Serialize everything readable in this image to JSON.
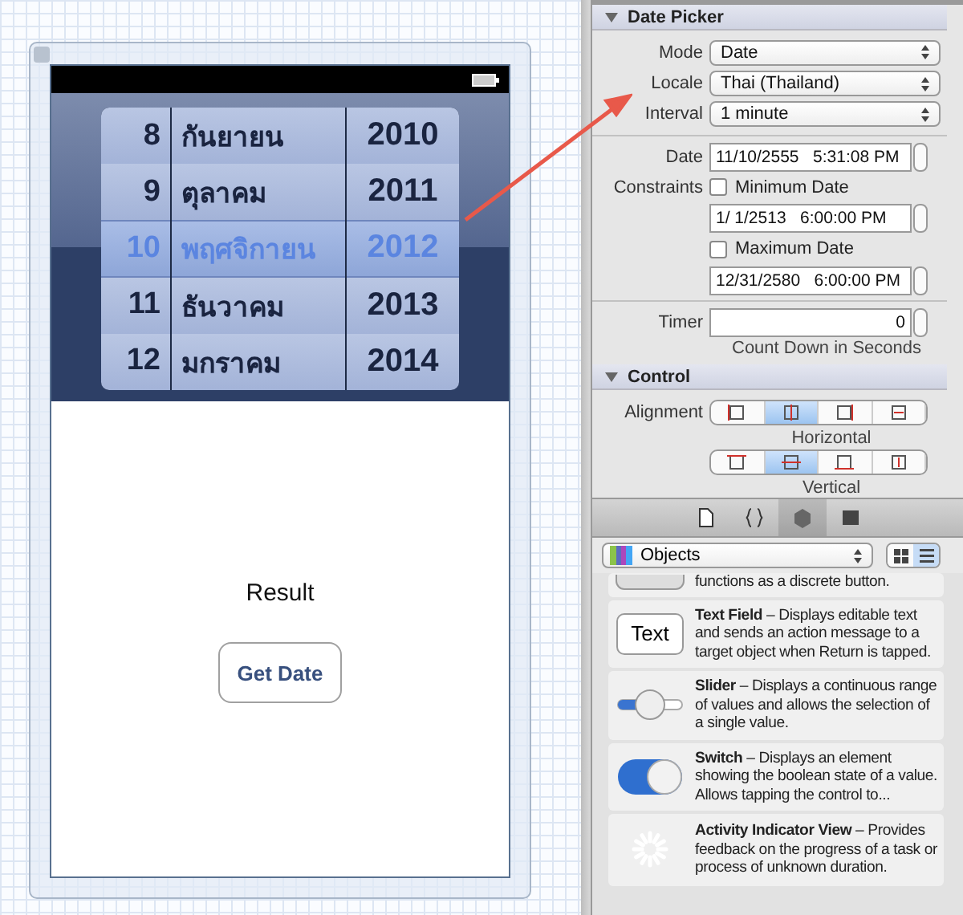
{
  "canvas": {
    "device": {
      "picker": {
        "rows": [
          {
            "day": "8",
            "month": "กันยายน",
            "year": "2010",
            "selected": false
          },
          {
            "day": "9",
            "month": "ตุลาคม",
            "year": "2011",
            "selected": false
          },
          {
            "day": "10",
            "month": "พฤศจิกายน",
            "year": "2012",
            "selected": true
          },
          {
            "day": "11",
            "month": "ธันวาคม",
            "year": "2013",
            "selected": false
          },
          {
            "day": "12",
            "month": "มกราคม",
            "year": "2014",
            "selected": false
          }
        ]
      },
      "result_label": "Result",
      "button": "Get Date"
    }
  },
  "inspector": {
    "date_picker": {
      "title": "Date Picker",
      "expanded": true,
      "selects": [
        {
          "label": "Mode",
          "value": "Date"
        },
        {
          "label": "Locale",
          "value": "Thai (Thailand)"
        },
        {
          "label": "Interval",
          "value": "1 minute"
        }
      ],
      "date": {
        "label": "Date",
        "value": "11/10/2555   5:31:08 PM"
      },
      "constraints": {
        "label": "Constraints",
        "items": [
          {
            "label": "Minimum Date",
            "checked": false,
            "value": "1/ 1/2513   6:00:00 PM"
          },
          {
            "label": "Maximum Date",
            "checked": false,
            "value": "12/31/2580   6:00:00 PM"
          }
        ]
      },
      "timer": {
        "label": "Timer",
        "value": "0",
        "caption": "Count Down in Seconds"
      }
    },
    "control": {
      "title": "Control",
      "expanded": true,
      "alignment": {
        "label": "Alignment",
        "groups": [
          {
            "caption": "Horizontal",
            "options": [
              {
                "kind": "left",
                "selected": false
              },
              {
                "kind": "center",
                "selected": true
              },
              {
                "kind": "right",
                "selected": false
              },
              {
                "kind": "fill",
                "selected": false
              }
            ]
          },
          {
            "caption": "Vertical",
            "options": [
              {
                "kind": "top",
                "selected": false
              },
              {
                "kind": "center",
                "selected": true
              },
              {
                "kind": "bottom",
                "selected": false
              },
              {
                "kind": "fill",
                "selected": false
              }
            ]
          }
        ]
      }
    }
  },
  "library": {
    "tabs": [
      {
        "kind": "file",
        "selected": false
      },
      {
        "kind": "code",
        "selected": false
      },
      {
        "kind": "object",
        "selected": true
      },
      {
        "kind": "media",
        "selected": false
      }
    ],
    "filter": "Objects",
    "views": [
      {
        "kind": "grid",
        "selected": false
      },
      {
        "kind": "list",
        "selected": true
      }
    ],
    "items": [
      {
        "kind": "stepper",
        "text": "functions as a discrete button."
      },
      {
        "kind": "textfield",
        "preview": "Text",
        "text": "**Text Field** – Displays editable text and sends an action message to a target object when Return is tapped."
      },
      {
        "kind": "slider",
        "text": "**Slider** – Displays a continuous range of values and allows the selection of a single value."
      },
      {
        "kind": "switch",
        "text": "**Switch** – Displays an element showing the boolean state of a value. Allows tapping the control to..."
      },
      {
        "kind": "activity",
        "text": "**Activity Indicator View** – Provides feedback on the progress of a task or process of unknown duration."
      }
    ]
  }
}
